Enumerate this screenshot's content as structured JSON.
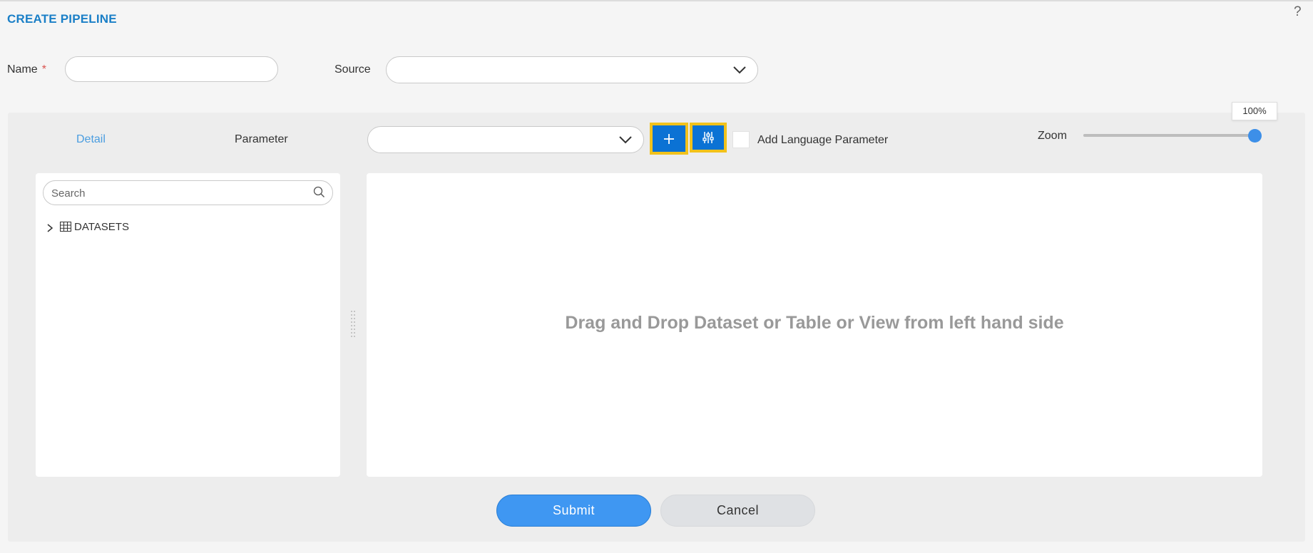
{
  "page": {
    "title": "CREATE PIPELINE",
    "help": "?"
  },
  "form": {
    "name_label": "Name",
    "required_mark": "*",
    "name_value": "",
    "source_label": "Source",
    "source_value": ""
  },
  "tabs": [
    {
      "label": "Detail",
      "active": true
    },
    {
      "label": "Parameter",
      "active": false
    }
  ],
  "toolbar": {
    "parameter_select_value": "",
    "add_button_icon": "plus-icon",
    "settings_button_icon": "sliders-icon",
    "language_checkbox_checked": false,
    "language_checkbox_label": "Add Language Parameter",
    "zoom_label": "Zoom",
    "zoom_percent": 100,
    "zoom_tooltip": "100%"
  },
  "explorer": {
    "search_placeholder": "Search",
    "tree": [
      {
        "label": "DATASETS",
        "icon": "table-grid-icon",
        "expanded": false
      }
    ]
  },
  "canvas": {
    "empty_message": "Drag and Drop Dataset or Table or View from left hand side"
  },
  "actions": {
    "submit_label": "Submit",
    "cancel_label": "Cancel"
  },
  "colors": {
    "title_blue": "#1a7fc7",
    "active_tab": "#4a9de0",
    "tool_button": "#0b72d4",
    "highlight_border": "#f2c21b",
    "submit": "#3f97f2",
    "cancel": "#dfe1e4"
  }
}
